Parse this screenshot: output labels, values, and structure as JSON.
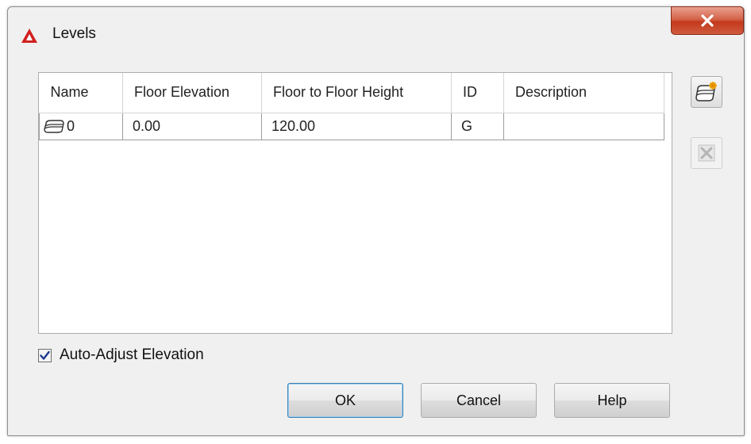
{
  "dialog": {
    "title": "Levels",
    "close_label": "x"
  },
  "table": {
    "columns": [
      "Name",
      "Floor Elevation",
      "Floor to Floor Height",
      "ID",
      "Description"
    ],
    "rows": [
      {
        "name": "0",
        "floor_elevation": "0.00",
        "floor_to_floor_height": "120.00",
        "id": "G",
        "description": ""
      }
    ]
  },
  "side_buttons": {
    "add_icon": "add-level-icon",
    "delete_icon": "delete-level-icon"
  },
  "options": {
    "auto_adjust_label": "Auto-Adjust Elevation",
    "auto_adjust_checked": true
  },
  "buttons": {
    "ok_label": "OK",
    "cancel_label": "Cancel",
    "help_label": "Help"
  },
  "colors": {
    "close_button": "#c4391c",
    "app_icon": "#d12020"
  }
}
